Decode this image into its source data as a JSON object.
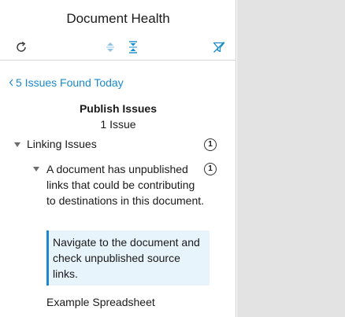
{
  "panel": {
    "title": "Document Health",
    "toolbar": {
      "icons": [
        "refresh-icon",
        "expand-all-icon",
        "collapse-all-icon",
        "clear-filter-icon"
      ]
    },
    "back_link": "5 Issues Found Today",
    "section": {
      "title": "Publish Issues",
      "count": "1 Issue"
    },
    "tree": {
      "group_label": "Linking Issues",
      "group_count": "1",
      "issue_label": "A document has unpublished links that could be contributing to destinations in this document.",
      "issue_count": "1",
      "recommendation": "Navigate to the document and check unpublished source links.",
      "affected_item": "Example Spreadsheet"
    }
  },
  "colors": {
    "accent": "#1a8acb",
    "callout_bg": "#e8f4fb",
    "gray_area": "#e3e3e3"
  }
}
